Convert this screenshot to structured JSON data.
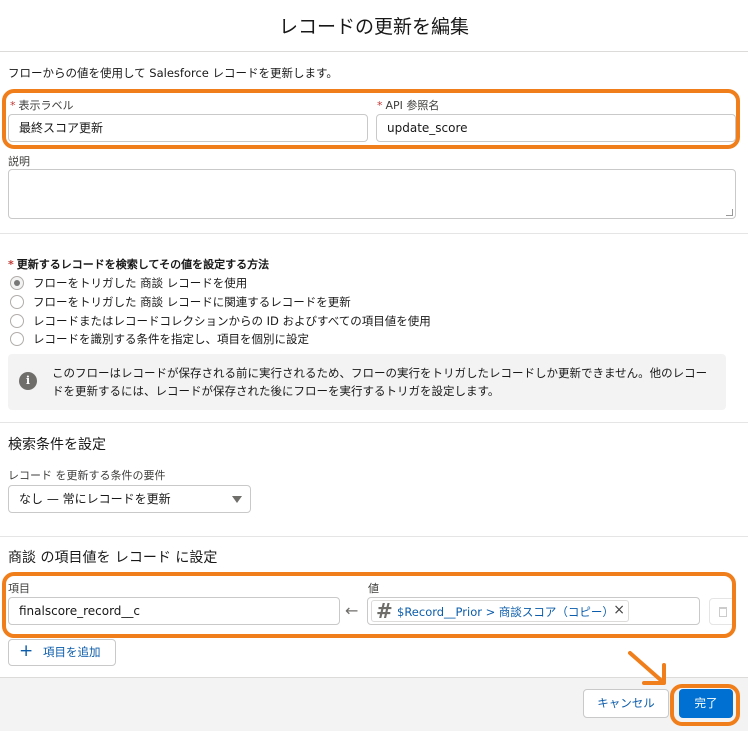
{
  "dialog": {
    "title": "レコードの更新を編集",
    "intro": "フローからの値を使用して Salesforce レコードを更新します。"
  },
  "fields": {
    "label_title": "表示ラベル",
    "label_value": "最終スコア更新",
    "api_title": "API 参照名",
    "api_value": "update_score",
    "description_title": "説明",
    "description_value": ""
  },
  "method": {
    "question": "更新するレコードを検索してその値を設定する方法",
    "options": [
      {
        "label": "フローをトリガした 商談 レコードを使用",
        "checked": true
      },
      {
        "label": "フローをトリガした 商談 レコードに関連するレコードを更新",
        "checked": false
      },
      {
        "label": "レコードまたはレコードコレクションからの ID およびすべての項目値を使用",
        "checked": false
      },
      {
        "label": "レコードを識別する条件を指定し、項目を個別に設定",
        "checked": false
      }
    ],
    "info_icon": "info-icon",
    "info_text": "このフローはレコードが保存される前に実行されるため、フローの実行をトリガしたレコードしか更新できません。他のレコードを更新するには、レコードが保存された後にフローを実行するトリガを設定します。"
  },
  "conditions": {
    "heading": "検索条件を設定",
    "requirement_label": "レコード を更新する条件の要件",
    "requirement_value": "なし — 常にレコードを更新"
  },
  "assign": {
    "heading": "商談 の項目値を レコード に設定",
    "field_label": "項目",
    "value_label": "値",
    "field_value": "finalscore_record__c",
    "arrow_icon": "left-arrow-icon",
    "value_pill": "$Record__Prior > 商談スコア（コピー）",
    "add_label": "項目を追加"
  },
  "footer": {
    "cancel_label": "キャンセル",
    "done_label": "完了"
  },
  "colors": {
    "highlight": "#f07e1a",
    "brand": "#0070d2",
    "link": "#0b5cab",
    "required": "#c23934"
  }
}
